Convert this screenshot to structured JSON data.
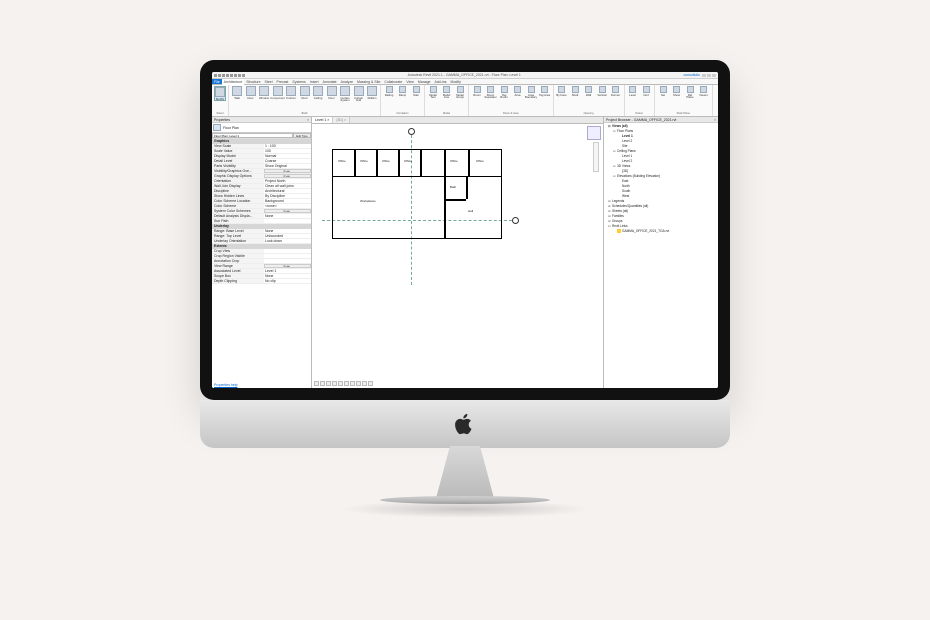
{
  "title_left": "Autodesk Revit 2021.1",
  "title_mid": "GAMMA_OFFICE_2021.rvt - Floor Plan: Level 1",
  "user": "consultolio",
  "ribbon_tabs": [
    "File",
    "Architecture",
    "Structure",
    "Steel",
    "Precast",
    "Systems",
    "Insert",
    "Annotate",
    "Analyze",
    "Massing & Site",
    "Collaborate",
    "View",
    "Manage",
    "Add-Ins",
    "Modify"
  ],
  "active_tab": "Architecture",
  "groups": {
    "select": {
      "name": "Select",
      "tools": [
        "Modify"
      ]
    },
    "build": {
      "name": "Build",
      "tools": [
        "Wall",
        "Door",
        "Window",
        "Component",
        "Column",
        "Roof",
        "Ceiling",
        "Floor",
        "Curtain System",
        "Curtain Grid",
        "Mullion"
      ]
    },
    "circulation": {
      "name": "Circulation",
      "tools": [
        "Railing",
        "Ramp",
        "Stair"
      ]
    },
    "model": {
      "name": "Model",
      "tools": [
        "Model Text",
        "Model Line",
        "Model Group"
      ]
    },
    "room": {
      "name": "Room & Area",
      "tools": [
        "Room",
        "Room Separator",
        "Tag Room",
        "Area",
        "Area Boundary",
        "Tag Area"
      ]
    },
    "opening": {
      "name": "Opening",
      "tools": [
        "By Face",
        "Shaft",
        "Wall",
        "Vertical",
        "Dormer"
      ]
    },
    "datum": {
      "name": "Datum",
      "tools": [
        "Level",
        "Grid"
      ]
    },
    "work": {
      "name": "Work Plane",
      "tools": [
        "Set",
        "Show",
        "Ref Plane",
        "Viewer"
      ]
    }
  },
  "props": {
    "title": "Properties",
    "type": "Floor Plan",
    "instance": "Floor Plan: Level 1",
    "edit_type": "Edit Type",
    "help": "Properties help",
    "cats": [
      {
        "name": "Graphics",
        "rows": [
          {
            "k": "View Scale",
            "v": "1 : 100"
          },
          {
            "k": "Scale Value",
            "v": "100"
          },
          {
            "k": "Display Model",
            "v": "Normal"
          },
          {
            "k": "Detail Level",
            "v": "Coarse"
          },
          {
            "k": "Parts Visibility",
            "v": "Show Original"
          },
          {
            "k": "Visibility/Graphics Ove...",
            "v": "Edit...",
            "btn": true
          },
          {
            "k": "Graphic Display Options",
            "v": "Edit...",
            "btn": true
          },
          {
            "k": "Orientation",
            "v": "Project North"
          },
          {
            "k": "Wall Join Display",
            "v": "Clean all wall joins"
          },
          {
            "k": "Discipline",
            "v": "Architectural"
          },
          {
            "k": "Show Hidden Lines",
            "v": "By Discipline"
          },
          {
            "k": "Color Scheme Location",
            "v": "Background"
          },
          {
            "k": "Color Scheme",
            "v": "<none>"
          },
          {
            "k": "System Color Schemes",
            "v": "Edit...",
            "btn": true
          },
          {
            "k": "Default Analysis Displa...",
            "v": "None"
          },
          {
            "k": "Sun Path",
            "v": ""
          }
        ]
      },
      {
        "name": "Underlay",
        "rows": [
          {
            "k": "Range: Base Level",
            "v": "None"
          },
          {
            "k": "Range: Top Level",
            "v": "Unbounded"
          },
          {
            "k": "Underlay Orientation",
            "v": "Look down"
          }
        ]
      },
      {
        "name": "Extents",
        "rows": [
          {
            "k": "Crop View",
            "v": ""
          },
          {
            "k": "Crop Region Visible",
            "v": ""
          },
          {
            "k": "Annotation Crop",
            "v": ""
          },
          {
            "k": "View Range",
            "v": "Edit...",
            "btn": true
          },
          {
            "k": "Associated Level",
            "v": "Level 1"
          },
          {
            "k": "Scope Box",
            "v": "None"
          },
          {
            "k": "Depth Clipping",
            "v": "No clip"
          }
        ]
      }
    ]
  },
  "view_tabs": [
    {
      "label": "Level 1",
      "active": true
    },
    {
      "label": "{3D}",
      "active": false
    }
  ],
  "rooms": [
    "Office",
    "Office",
    "Office",
    "Office",
    "Office",
    "Office",
    "Workplaces",
    "Bath",
    "Hall"
  ],
  "browser": {
    "title": "Project Browser - GAMMA_OFFICE_2021.rvt",
    "nodes": [
      {
        "t": "Views (all)",
        "l": 0,
        "exp": "−",
        "b": true
      },
      {
        "t": "Floor Plans",
        "l": 1,
        "exp": "−"
      },
      {
        "t": "Level 1",
        "l": 2,
        "b": true
      },
      {
        "t": "Level 2",
        "l": 2
      },
      {
        "t": "Site",
        "l": 2
      },
      {
        "t": "Ceiling Plans",
        "l": 1,
        "exp": "−"
      },
      {
        "t": "Level 1",
        "l": 2
      },
      {
        "t": "Level 2",
        "l": 2
      },
      {
        "t": "3D Views",
        "l": 1,
        "exp": "−"
      },
      {
        "t": "{3D}",
        "l": 2
      },
      {
        "t": "Elevations (Building Elevation)",
        "l": 1,
        "exp": "−"
      },
      {
        "t": "East",
        "l": 2
      },
      {
        "t": "North",
        "l": 2
      },
      {
        "t": "South",
        "l": 2
      },
      {
        "t": "West",
        "l": 2
      },
      {
        "t": "Legends",
        "l": 0,
        "exp": "+"
      },
      {
        "t": "Schedules/Quantities (all)",
        "l": 0,
        "exp": "+"
      },
      {
        "t": "Sheets (all)",
        "l": 0,
        "exp": "+"
      },
      {
        "t": "Families",
        "l": 0,
        "exp": "+"
      },
      {
        "t": "Groups",
        "l": 0,
        "exp": "+"
      },
      {
        "t": "Revit Links",
        "l": 0,
        "exp": "−"
      },
      {
        "t": "GAMMA_OFFICE_2021_TGA.rvt",
        "l": 1,
        "ylw": true
      }
    ]
  }
}
